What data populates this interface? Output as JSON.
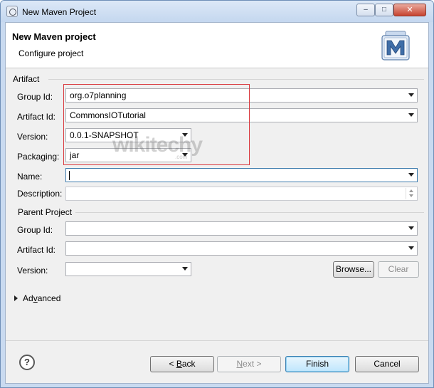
{
  "window": {
    "title": "New Maven Project",
    "minimize_glyph": "–",
    "maximize_glyph": "□",
    "close_glyph": "✕"
  },
  "header": {
    "title": "New Maven project",
    "description": "Configure project"
  },
  "artifact": {
    "group_title": "Artifact",
    "group_id": {
      "label": "Group Id:",
      "value": "org.o7planning"
    },
    "artifact_id": {
      "label": "Artifact Id:",
      "value": "CommonsIOTutorial"
    },
    "version": {
      "label": "Version:",
      "value": "0.0.1-SNAPSHOT"
    },
    "packaging": {
      "label": "Packaging:",
      "value": "jar"
    },
    "name": {
      "label": "Name:",
      "value": ""
    },
    "description": {
      "label": "Description:",
      "value": ""
    }
  },
  "parent": {
    "group_title": "Parent Project",
    "group_id": {
      "label": "Group Id:",
      "value": ""
    },
    "artifact_id": {
      "label": "Artifact Id:",
      "value": ""
    },
    "version": {
      "label": "Version:",
      "value": ""
    },
    "browse_label": "Browse...",
    "clear_label": "Clear"
  },
  "advanced": {
    "label_prefix": "Ad",
    "label_mnemonic": "v",
    "label_suffix": "anced"
  },
  "footer": {
    "help_glyph": "?",
    "back_prefix": "< ",
    "back_mnemonic": "B",
    "back_suffix": "ack",
    "next_prefix": "",
    "next_mnemonic": "N",
    "next_suffix": "ext >",
    "finish_label": "Finish",
    "cancel_label": "Cancel"
  },
  "watermark": {
    "text": "wikitechy",
    "sub": ".com"
  },
  "colors": {
    "highlight_box": "#d9393e",
    "default_button": "#3c7fb1",
    "maven_icon": "#3f6ea8"
  },
  "icons": {
    "app": "eclipse-icon",
    "maven": "maven-m-icon",
    "help": "help-icon"
  }
}
